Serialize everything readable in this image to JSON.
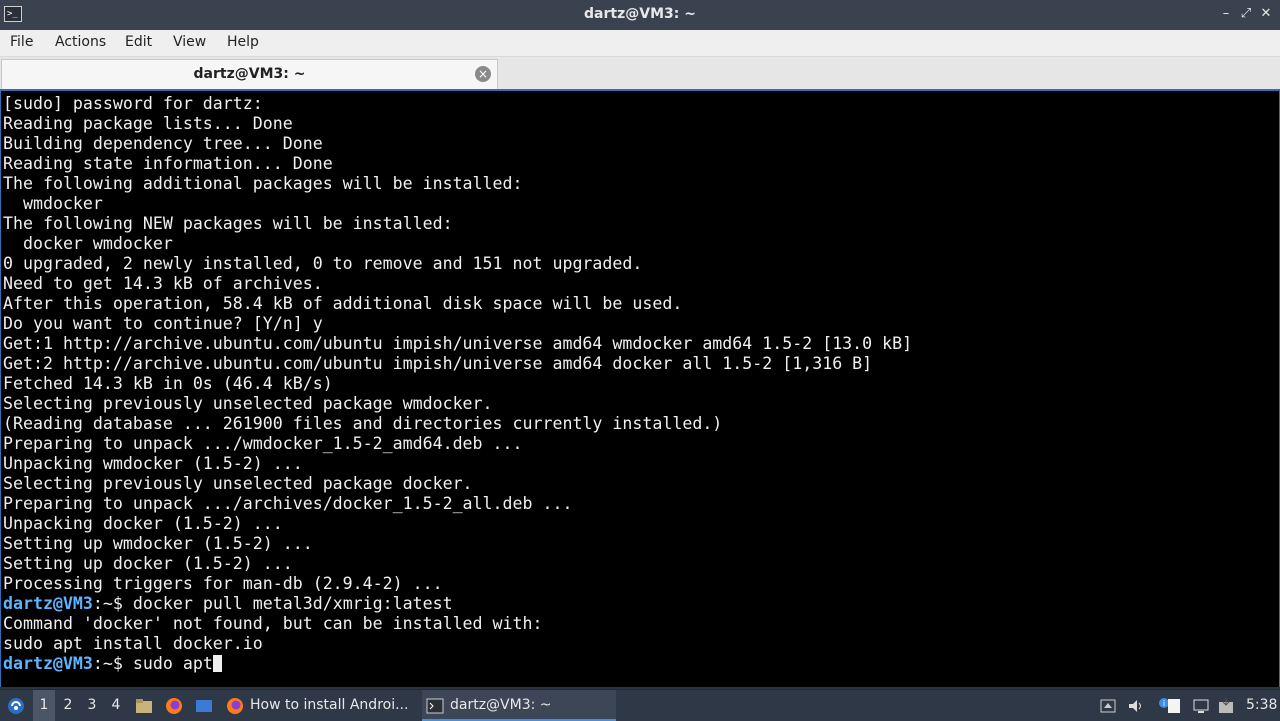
{
  "window": {
    "title": "dartz@VM3: ~",
    "app_icon": "terminal-icon",
    "controls": {
      "minimize": "–",
      "restore": "⤢",
      "close": "✕"
    }
  },
  "menu": [
    "File",
    "Actions",
    "Edit",
    "View",
    "Help"
  ],
  "tab": {
    "label": "dartz@VM3: ~",
    "close_icon": "×"
  },
  "colors": {
    "prompt": "#5fb4ff",
    "terminal_bg": "#000000",
    "text": "#f0f0f0",
    "accent": "#2f6fb5"
  },
  "terminal": {
    "lines": [
      {
        "text": "[sudo] password for dartz:"
      },
      {
        "text": "Reading package lists... Done"
      },
      {
        "text": "Building dependency tree... Done"
      },
      {
        "text": "Reading state information... Done"
      },
      {
        "text": "The following additional packages will be installed:"
      },
      {
        "text": "  wmdocker"
      },
      {
        "text": "The following NEW packages will be installed:"
      },
      {
        "text": "  docker wmdocker"
      },
      {
        "text": "0 upgraded, 2 newly installed, 0 to remove and 151 not upgraded."
      },
      {
        "text": "Need to get 14.3 kB of archives."
      },
      {
        "text": "After this operation, 58.4 kB of additional disk space will be used."
      },
      {
        "text": "Do you want to continue? [Y/n] y"
      },
      {
        "text": "Get:1 http://archive.ubuntu.com/ubuntu impish/universe amd64 wmdocker amd64 1.5-2 [13.0 kB]"
      },
      {
        "text": "Get:2 http://archive.ubuntu.com/ubuntu impish/universe amd64 docker all 1.5-2 [1,316 B]"
      },
      {
        "text": "Fetched 14.3 kB in 0s (46.4 kB/s)"
      },
      {
        "text": "Selecting previously unselected package wmdocker."
      },
      {
        "text": "(Reading database ... 261900 files and directories currently installed.)"
      },
      {
        "text": "Preparing to unpack .../wmdocker_1.5-2_amd64.deb ..."
      },
      {
        "text": "Unpacking wmdocker (1.5-2) ..."
      },
      {
        "text": "Selecting previously unselected package docker."
      },
      {
        "text": "Preparing to unpack .../archives/docker_1.5-2_all.deb ..."
      },
      {
        "text": "Unpacking docker (1.5-2) ..."
      },
      {
        "text": "Setting up wmdocker (1.5-2) ..."
      },
      {
        "text": "Setting up docker (1.5-2) ..."
      },
      {
        "text": "Processing triggers for man-db (2.9.4-2) ..."
      },
      {
        "prompt": "dartz@VM3",
        "path": ":~$",
        "text": " docker pull metal3d/xmrig:latest"
      },
      {
        "text": "Command 'docker' not found, but can be installed with:"
      },
      {
        "text": "sudo apt install docker.io"
      },
      {
        "prompt": "dartz@VM3",
        "path": ":~$",
        "text": " sudo apt",
        "cursor": true
      }
    ]
  },
  "taskbar": {
    "start_icon": "start-menu-icon",
    "workspaces": [
      "1",
      "2",
      "3",
      "4"
    ],
    "active_workspace": "1",
    "launchers": [
      "files-icon",
      "firefox-icon",
      "desktop-icon"
    ],
    "tasks": [
      {
        "label": "How to install Androi...",
        "icon": "firefox-icon",
        "active": false
      },
      {
        "label": "dartz@VM3: ~",
        "icon": "terminal-icon",
        "active": true
      }
    ],
    "tray": [
      "keyboard-icon",
      "volume-icon",
      "notification-icon",
      "clipboard-icon",
      "network-icon",
      "updates-icon"
    ],
    "clock": "5:38"
  }
}
